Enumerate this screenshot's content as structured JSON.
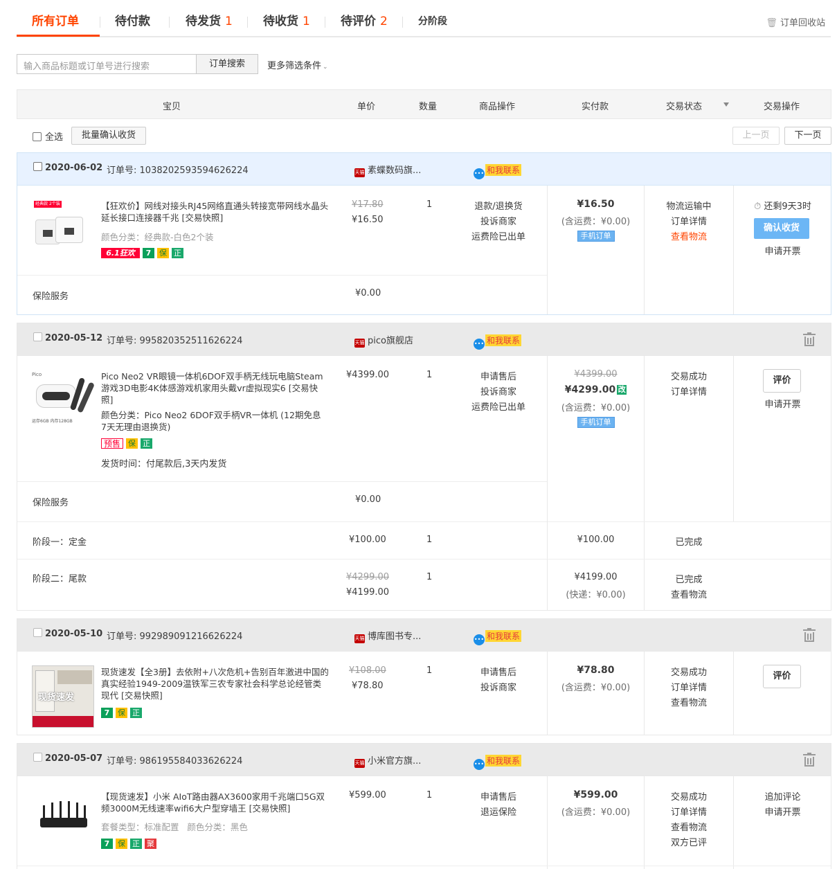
{
  "tabs": [
    {
      "label": "所有订单",
      "count": ""
    },
    {
      "label": "待付款",
      "count": ""
    },
    {
      "label": "待发货",
      "count": "1"
    },
    {
      "label": "待收货",
      "count": "1"
    },
    {
      "label": "待评价",
      "count": "2"
    },
    {
      "label": "分阶段",
      "count": ""
    }
  ],
  "recycle_label": "订单回收站",
  "search": {
    "placeholder": "输入商品标题或订单号进行搜索",
    "button": "订单搜索",
    "more": "更多筛选条件"
  },
  "table_headers": [
    "宝贝",
    "单价",
    "数量",
    "商品操作",
    "实付款",
    "交易状态",
    "交易操作"
  ],
  "toolbar": {
    "select_all": "全选",
    "batch_confirm": "批量确认收货",
    "prev": "上一页",
    "next": "下一页"
  },
  "contact_label": "和我联系",
  "tmall_label": "天猫",
  "orders": [
    {
      "date": "2020-06-02",
      "order_no_label": "订单号:",
      "order_no": "1038202593594626224",
      "shop": "素蝶数码旗...",
      "title": "【狂欢价】网线对接头RJ45网络直通头转接宽带网线水晶头延长接口连接器千兆 [交易快照]",
      "sku": "颜色分类：经典款-白色2个装",
      "image_tag": "经典款 2个装",
      "badges": [
        "6.1狂欢",
        "7",
        "保",
        "正"
      ],
      "orig_price": "¥17.80",
      "price": "¥16.50",
      "qty": "1",
      "item_ops": [
        "退款/退换货",
        "投诉商家",
        "运费险已出单"
      ],
      "paid": "¥16.50",
      "shipping": "(含运费：¥0.00)",
      "mobile": "手机订单",
      "status": [
        "物流运输中",
        "订单详情",
        "查看物流"
      ],
      "remaining": "还剩9天3时",
      "confirm": "确认收货",
      "invoice": "申请开票",
      "insurance_label": "保险服务",
      "insurance_price": "¥0.00"
    },
    {
      "date": "2020-05-12",
      "order_no_label": "订单号:",
      "order_no": "995820352511626224",
      "shop": "pico旗舰店",
      "title": "Pico Neo2 VR眼镜一体机6DOF双手柄无线玩电脑Steam游戏3D电影4K体感游戏机家用头戴vr虚拟现实6 [交易快照]",
      "sku": "颜色分类：Pico Neo2 6DOF双手柄VR一体机 (12期免息7天无理由退换货)",
      "image_brand": "Pico",
      "image_spec": "运存6GB 内存128GB",
      "badges": [
        "预售",
        "保",
        "正"
      ],
      "ship_time": "发货时间：付尾款后,3天内发货",
      "price": "¥4399.00",
      "qty": "1",
      "item_ops": [
        "申请售后",
        "投诉商家",
        "运费险已出单"
      ],
      "orig_paid": "¥4399.00",
      "paid": "¥4299.00",
      "gai": "改",
      "shipping": "(含运费：¥0.00)",
      "mobile": "手机订单",
      "status": [
        "交易成功",
        "订单详情"
      ],
      "rate": "评价",
      "invoice": "申请开票",
      "insurance_label": "保险服务",
      "insurance_price": "¥0.00",
      "stages": [
        {
          "label": "阶段一：定金",
          "price": "¥100.00",
          "qty": "1",
          "paid": "¥100.00",
          "status": "已完成"
        },
        {
          "label": "阶段二：尾款",
          "orig_price": "¥4299.00",
          "price": "¥4199.00",
          "qty": "1",
          "paid": "¥4199.00",
          "shipping": "(快递：¥0.00)",
          "status": "已完成",
          "status2": "查看物流"
        }
      ]
    },
    {
      "date": "2020-05-10",
      "order_no_label": "订单号:",
      "order_no": "992989091216626224",
      "shop": "博库图书专...",
      "title": "现货速发【全3册】去依附+八次危机+告别百年激进中国的真实经验1949-2009温铁军三农专家社会科学总论经管类现代 [交易快照]",
      "image_text": "现货速发",
      "badges": [
        "7",
        "保",
        "正"
      ],
      "orig_price": "¥108.00",
      "price": "¥78.80",
      "qty": "1",
      "item_ops": [
        "申请售后",
        "投诉商家"
      ],
      "paid": "¥78.80",
      "shipping": "(含运费：¥0.00)",
      "status": [
        "交易成功",
        "订单详情",
        "查看物流"
      ],
      "rate": "评价"
    },
    {
      "date": "2020-05-07",
      "order_no_label": "订单号:",
      "order_no": "986195584033626224",
      "shop": "小米官方旗...",
      "title": "【现货速发】小米 AIoT路由器AX3600家用千兆端口5G双频3000M无线速率wifi6大户型穿墙王 [交易快照]",
      "sku": "套餐类型：标准配置   颜色分类：黑色",
      "badges": [
        "7",
        "保",
        "正",
        "聚"
      ],
      "price": "¥599.00",
      "qty": "1",
      "item_ops": [
        "申请售后",
        "退运保险"
      ],
      "paid": "¥599.00",
      "shipping": "(含运费：¥0.00)",
      "status": [
        "交易成功",
        "订单详情",
        "查看物流",
        "双方已评"
      ],
      "actions": [
        "追加评论",
        "申请开票"
      ]
    }
  ],
  "colors": {
    "accent": "#ff4400",
    "confirm_button": "#6cb6f5",
    "first_order_header": "#e8f2ff"
  }
}
